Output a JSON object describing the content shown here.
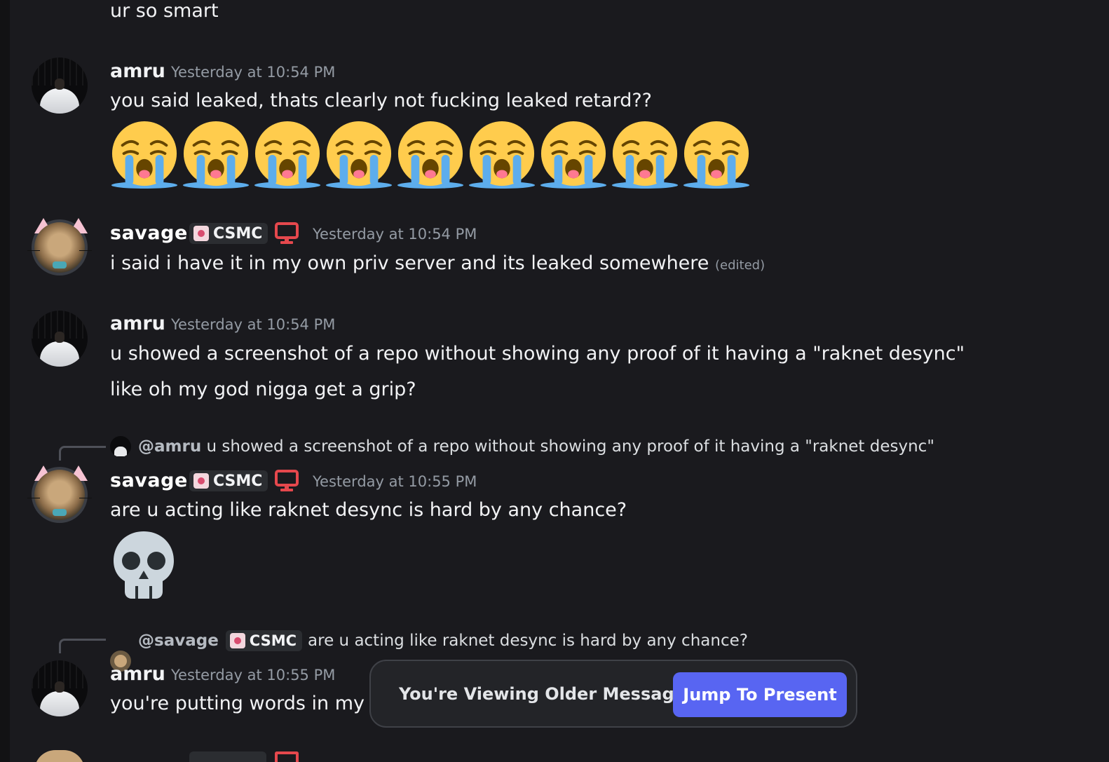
{
  "colors": {
    "background": "#1a1a1e",
    "accent": "#5865f2",
    "monitor": "#e5484d",
    "timestamp": "#949ba4"
  },
  "messages": [
    {
      "text": "ur so smart"
    },
    {
      "author": "amru",
      "timestamp": "Yesterday at 10:54 PM",
      "text": "you said leaked, thats clearly not fucking leaked retard??",
      "emojis": "loudly-crying-face x9"
    },
    {
      "author": "savage",
      "role_tag": "CSMC",
      "timestamp": "Yesterday at 10:54 PM",
      "text": "i said i have it in my own priv server and its leaked somewhere",
      "edited": "(edited)"
    },
    {
      "author": "amru",
      "timestamp": "Yesterday at 10:54 PM",
      "text": "u showed a screenshot of a repo without showing any proof of it having a \"raknet desync\"",
      "text2": "like oh my god nigga get a grip?"
    },
    {
      "reply": {
        "mention": "@amru",
        "text": "u showed a screenshot of a repo without showing any proof of it having a \"raknet desync\""
      },
      "author": "savage",
      "role_tag": "CSMC",
      "timestamp": "Yesterday at 10:55 PM",
      "text": "are u acting like raknet desync is hard by any chance?",
      "emoji": "skull"
    },
    {
      "reply": {
        "mention": "@savage",
        "role_tag": "CSMC",
        "text": "are u acting like raknet desync is hard by any chance?"
      },
      "author": "amru",
      "timestamp": "Yesterday at 10:55 PM",
      "text": "you're putting words in my r"
    }
  ],
  "banner": {
    "text": "You're Viewing Older Messages",
    "button": "Jump To Present"
  }
}
